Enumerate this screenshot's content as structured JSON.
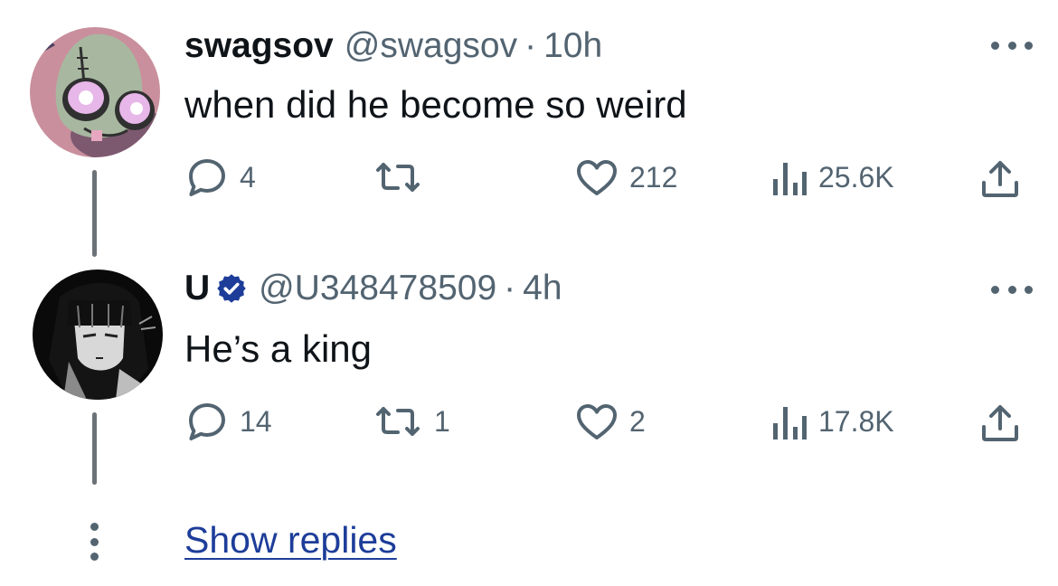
{
  "tweets": [
    {
      "display_name": "swagsov",
      "handle": "@swagsov",
      "separator": "·",
      "time": "10h",
      "text": "when did he become so weird",
      "replies": "4",
      "reposts": "",
      "likes": "212",
      "views": "25.6K",
      "verified": false,
      "avatar_icon": "cartoon-alien-avatar"
    },
    {
      "display_name": "U",
      "handle": "@U348478509",
      "separator": "·",
      "time": "4h",
      "text": "He’s a king",
      "replies": "14",
      "reposts": "1",
      "likes": "2",
      "views": "17.8K",
      "verified": true,
      "avatar_icon": "anime-girl-avatar"
    }
  ],
  "show_replies_label": "Show replies",
  "colors": {
    "text": "#0f1419",
    "secondary": "#536471",
    "link": "#1d3d99",
    "verified_badge": "#1d3d99"
  }
}
